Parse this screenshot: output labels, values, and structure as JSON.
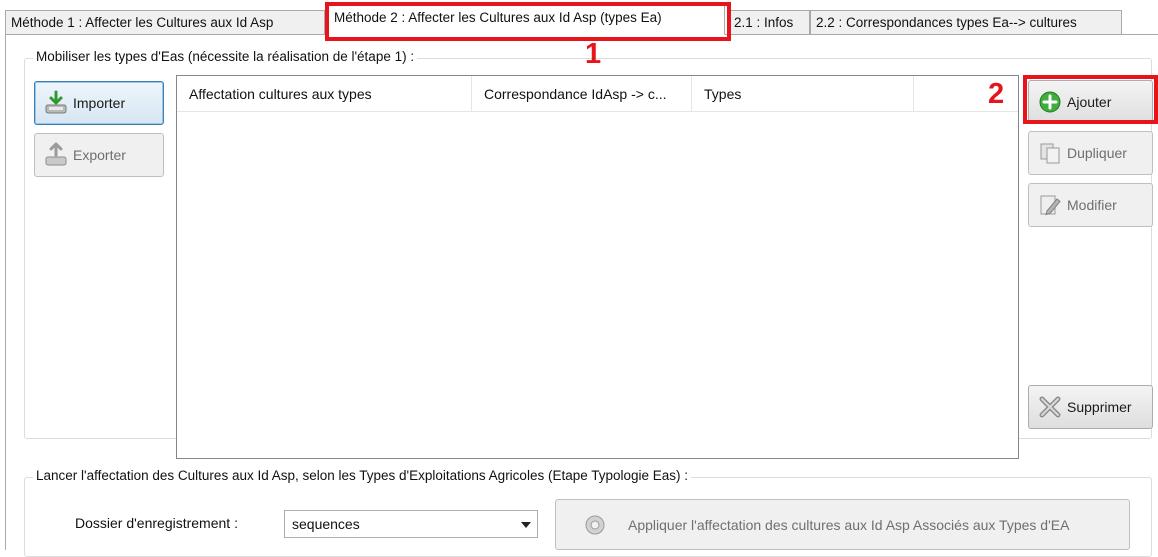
{
  "tabs": [
    {
      "label": "Méthode 1 : Affecter les Cultures aux Id Asp",
      "active": false
    },
    {
      "label": "Méthode 2 : Affecter les Cultures aux Id Asp (types Ea)",
      "active": true
    },
    {
      "label": "2.1 : Infos",
      "active": false
    },
    {
      "label": "2.2 : Correspondances types Ea--> cultures",
      "active": false
    }
  ],
  "annotations": {
    "tab_marker": "1",
    "add_marker": "2",
    "color": "#e8141c"
  },
  "group_types": {
    "legend": "Mobiliser les types d'Eas (nécessite la réalisation de l'étape 1) :",
    "import_label": "Importer",
    "export_label": "Exporter",
    "columns": [
      "Affectation cultures aux types",
      "Correspondance IdAsp -> c...",
      "Types",
      ""
    ],
    "add_label": "Ajouter",
    "duplicate_label": "Dupliquer",
    "modify_label": "Modifier",
    "delete_label": "Supprimer"
  },
  "group_launch": {
    "legend": "Lancer l'affectation des Cultures aux Id Asp, selon les Types d'Exploitations Agricoles (Etape Typologie Eas) :",
    "folder_label": "Dossier d'enregistrement :",
    "folder_value": "sequences",
    "apply_label": "Appliquer l'affectation des cultures aux Id Asp Associés aux Types d'EA"
  },
  "icons": {
    "import": "import-icon",
    "export": "export-icon",
    "add": "add-circle-icon",
    "duplicate": "duplicate-icon",
    "modify": "edit-icon",
    "delete": "delete-x-icon",
    "apply": "gear-icon",
    "combo_arrow": "chevron-down-icon"
  }
}
